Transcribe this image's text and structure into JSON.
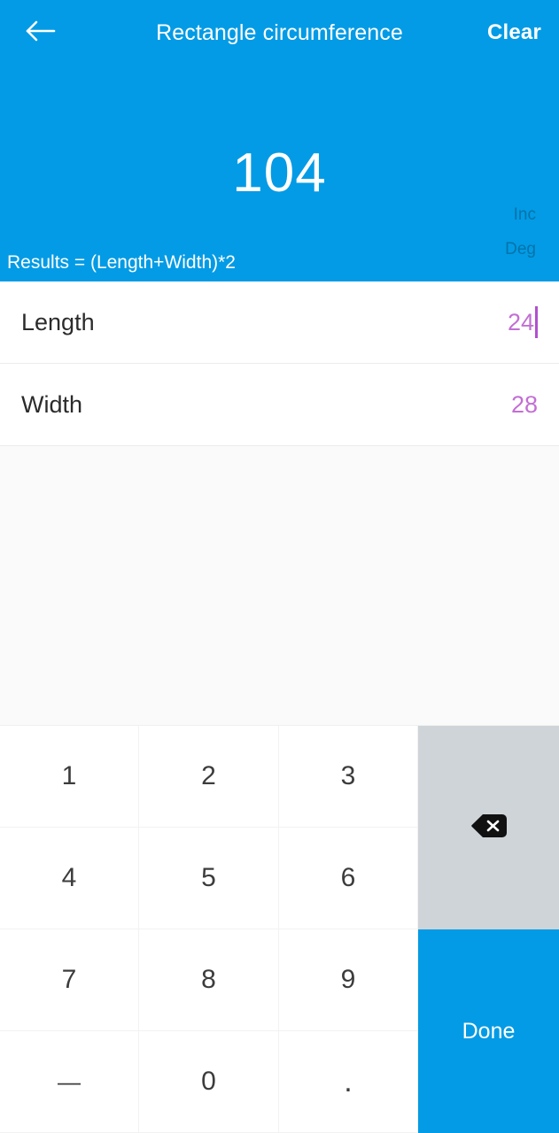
{
  "header": {
    "back_icon": "arrow-left-icon",
    "title": "Rectangle circumference",
    "clear_label": "Clear",
    "result_value": "104",
    "formula": "Results = (Length+Width)*2",
    "modes": [
      {
        "label": "Inc"
      },
      {
        "label": "Deg"
      }
    ],
    "accent_color": "#039BE5"
  },
  "inputs": {
    "value_color": "#c26fd4",
    "rows": [
      {
        "label": "Length",
        "value": "24",
        "focused": true
      },
      {
        "label": "Width",
        "value": "28",
        "focused": false
      }
    ]
  },
  "keypad": {
    "keys": [
      {
        "label": "1",
        "name": "key-1"
      },
      {
        "label": "2",
        "name": "key-2"
      },
      {
        "label": "3",
        "name": "key-3"
      },
      {
        "label": "4",
        "name": "key-4"
      },
      {
        "label": "5",
        "name": "key-5"
      },
      {
        "label": "6",
        "name": "key-6"
      },
      {
        "label": "7",
        "name": "key-7"
      },
      {
        "label": "8",
        "name": "key-8"
      },
      {
        "label": "9",
        "name": "key-9"
      },
      {
        "label": "—",
        "name": "key-minus"
      },
      {
        "label": "0",
        "name": "key-0"
      },
      {
        "label": ".",
        "name": "key-decimal"
      }
    ],
    "backspace_icon": "backspace-icon",
    "done_label": "Done",
    "done_color": "#039BE5",
    "backspace_bg": "#cfd4d8"
  }
}
